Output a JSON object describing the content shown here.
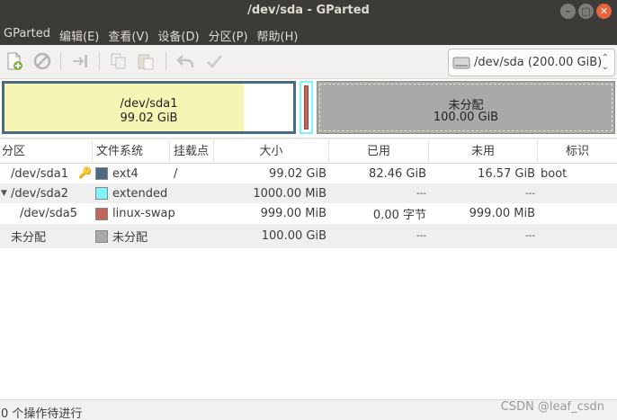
{
  "window": {
    "title": "/dev/sda - GParted"
  },
  "menu": [
    "GParted",
    "编辑(E)",
    "查看(V)",
    "设备(D)",
    "分区(P)",
    "帮助(H)"
  ],
  "toolbar": {
    "buttons": [
      "new-partition",
      "delete-partition",
      "resize-move",
      "copy",
      "paste",
      "undo",
      "apply"
    ],
    "device_selector": "/dev/sda  (200.00 GiB)"
  },
  "partition_map": {
    "sda1": {
      "name": "/dev/sda1",
      "size": "99.02 GiB",
      "used_fraction": 0.83,
      "color": "#f7f5b3"
    },
    "unallocated": {
      "name": "未分配",
      "size": "100.00 GiB",
      "color": "#a9a9a9"
    }
  },
  "table": {
    "headers": [
      "分区",
      "文件系统",
      "挂载点",
      "大小",
      "已用",
      "未用",
      "标识"
    ],
    "rows": [
      {
        "partition": "/dev/sda1",
        "fs": "ext4",
        "fs_color": "#4b6983",
        "mount": "/",
        "size": "99.02 GiB",
        "used": "82.46 GiB",
        "unused": "16.57 GiB",
        "flags": "boot"
      },
      {
        "partition": "/dev/sda2",
        "fs": "extended",
        "fs_color": "#7ef4fc",
        "mount": "",
        "size": "1000.00 MiB",
        "used": "---",
        "unused": "---",
        "flags": ""
      },
      {
        "partition": "/dev/sda5",
        "fs": "linux-swap",
        "fs_color": "#c1665a",
        "mount": "",
        "size": "999.00 MiB",
        "used": "0.00 字节",
        "unused": "999.00 MiB",
        "flags": ""
      },
      {
        "partition": "未分配",
        "fs": "未分配",
        "fs_color": "#a9a9a9",
        "mount": "",
        "size": "100.00 GiB",
        "used": "---",
        "unused": "---",
        "flags": ""
      }
    ]
  },
  "status": {
    "text": "0 个操作待进行"
  },
  "watermark": "CSDN @leaf_csdn"
}
